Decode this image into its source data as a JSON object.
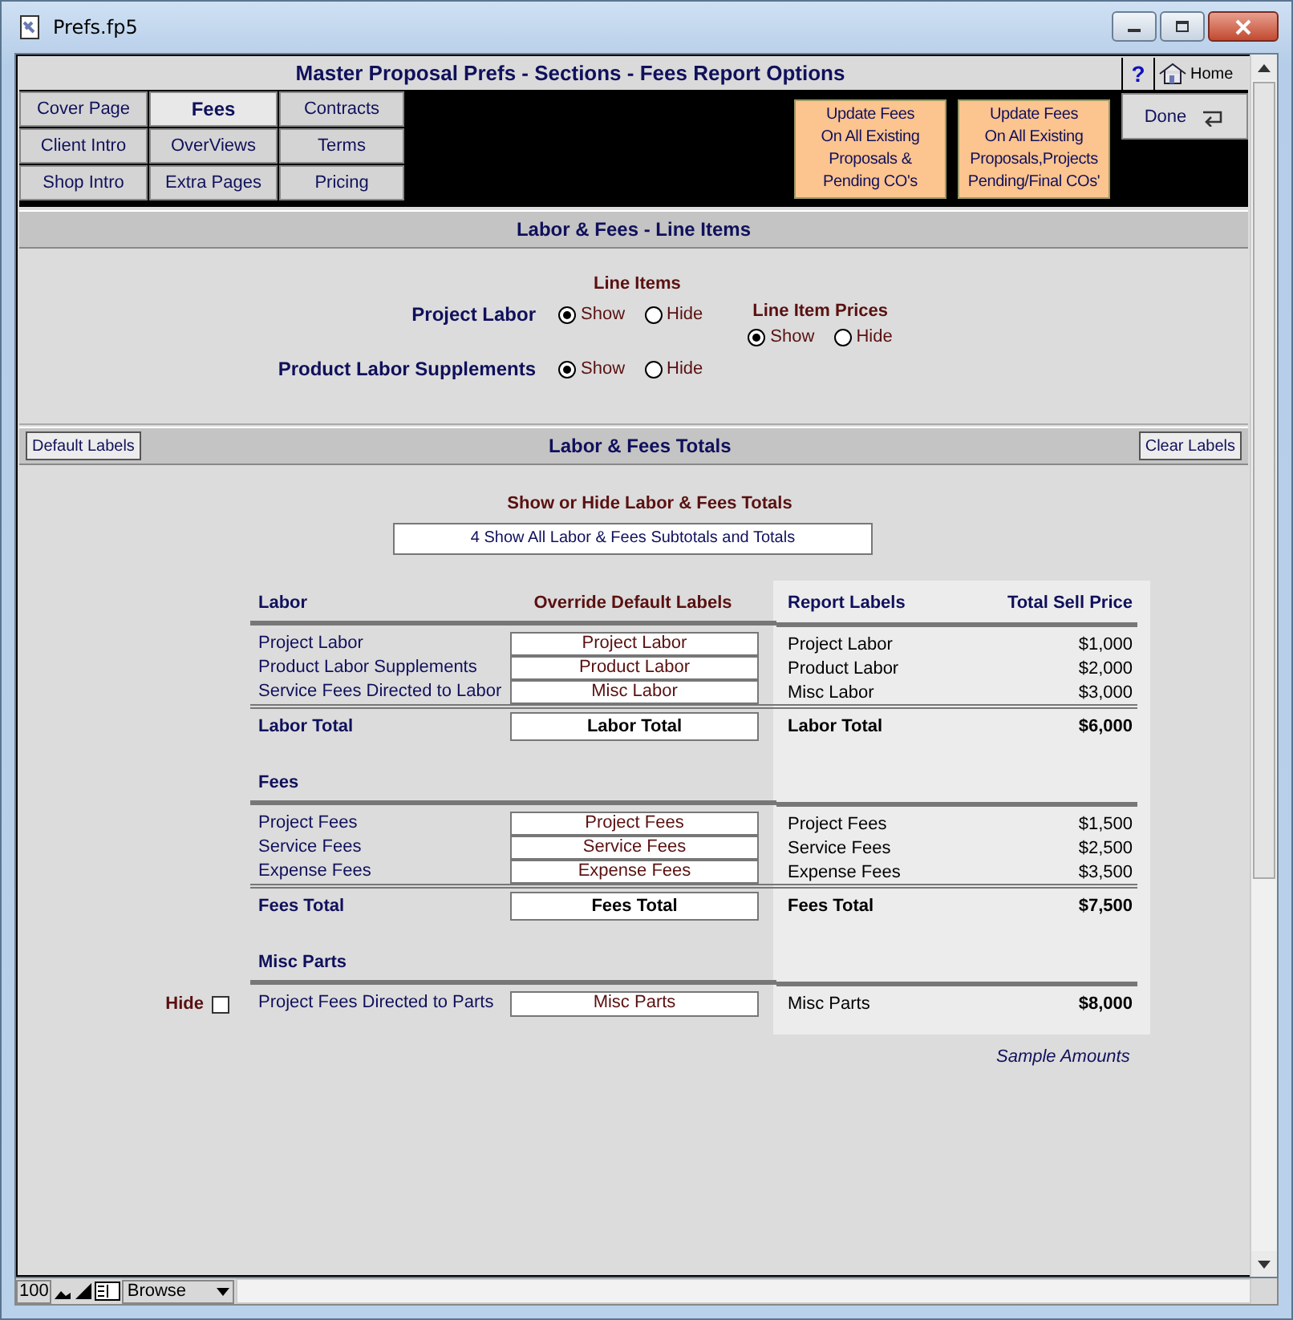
{
  "window": {
    "title": "Prefs.fp5"
  },
  "header": {
    "title": "Master Proposal Prefs - Sections - Fees Report Options",
    "help": "?",
    "home": "Home",
    "done": "Done"
  },
  "nav_tabs": [
    {
      "label": "Cover Page",
      "selected": false
    },
    {
      "label": "Fees",
      "selected": true
    },
    {
      "label": "Contracts",
      "selected": false
    },
    {
      "label": "Client Intro",
      "selected": false
    },
    {
      "label": "OverViews",
      "selected": false
    },
    {
      "label": "Terms",
      "selected": false
    },
    {
      "label": "Shop Intro",
      "selected": false
    },
    {
      "label": "Extra Pages",
      "selected": false
    },
    {
      "label": "Pricing",
      "selected": false
    }
  ],
  "update_buttons": [
    {
      "lines": [
        "Update Fees",
        "On All Existing",
        "Proposals &",
        "Pending CO's"
      ]
    },
    {
      "lines": [
        "Update Fees",
        "On All Existing",
        "Proposals,Projects",
        "Pending/Final COs'"
      ]
    }
  ],
  "line_items_section": {
    "title": "Labor & Fees -  Line Items",
    "heading": "Line Items",
    "rows": [
      {
        "label": "Project Labor",
        "options": [
          {
            "label": "Show",
            "selected": true
          },
          {
            "label": "Hide",
            "selected": false
          }
        ]
      },
      {
        "label": "Product Labor Supplements",
        "options": [
          {
            "label": "Show",
            "selected": true
          },
          {
            "label": "Hide",
            "selected": false
          }
        ]
      }
    ],
    "prices": {
      "heading": "Line Item Prices",
      "options": [
        {
          "label": "Show",
          "selected": true
        },
        {
          "label": "Hide",
          "selected": false
        }
      ]
    }
  },
  "totals_section": {
    "title": "Labor & Fees Totals",
    "default_button": "Default Labels",
    "clear_button": "Clear Labels",
    "show_hide_heading": "Show or Hide Labor & Fees Totals",
    "show_hide_value": "4 Show All Labor & Fees Subtotals and Totals",
    "columns": [
      "Override Default Labels",
      "Report Labels",
      "Total Sell Price"
    ],
    "groups": [
      {
        "heading": "Labor",
        "rows": [
          {
            "name": "Project Labor",
            "override": "Project Labor",
            "report": "Project Labor",
            "price": "$1,000"
          },
          {
            "name": "Product Labor Supplements",
            "override": "Product Labor",
            "report": "Product Labor",
            "price": "$2,000"
          },
          {
            "name": "Service Fees Directed to Labor",
            "override": "Misc Labor",
            "report": "Misc Labor",
            "price": "$3,000"
          }
        ],
        "total": {
          "name": "Labor Total",
          "override": "Labor Total",
          "report": "Labor Total",
          "price": "$6,000"
        }
      },
      {
        "heading": "Fees",
        "rows": [
          {
            "name": "Project Fees",
            "override": "Project Fees",
            "report": "Project Fees",
            "price": "$1,500"
          },
          {
            "name": "Service Fees",
            "override": "Service Fees",
            "report": "Service Fees",
            "price": "$2,500"
          },
          {
            "name": "Expense Fees",
            "override": "Expense Fees",
            "report": "Expense Fees",
            "price": "$3,500"
          }
        ],
        "total": {
          "name": "Fees Total",
          "override": "Fees Total",
          "report": "Fees Total",
          "price": "$7,500"
        }
      },
      {
        "heading": "Misc Parts",
        "hide_label": "Hide",
        "hidden": false,
        "rows": [
          {
            "name": "Project Fees Directed to Parts",
            "override": "Misc Parts",
            "report": "Misc Parts",
            "price": "$8,000",
            "bold_price": true
          }
        ]
      }
    ],
    "note": "Sample Amounts"
  },
  "status_bar": {
    "zoom": "100",
    "mode": "Browse"
  }
}
